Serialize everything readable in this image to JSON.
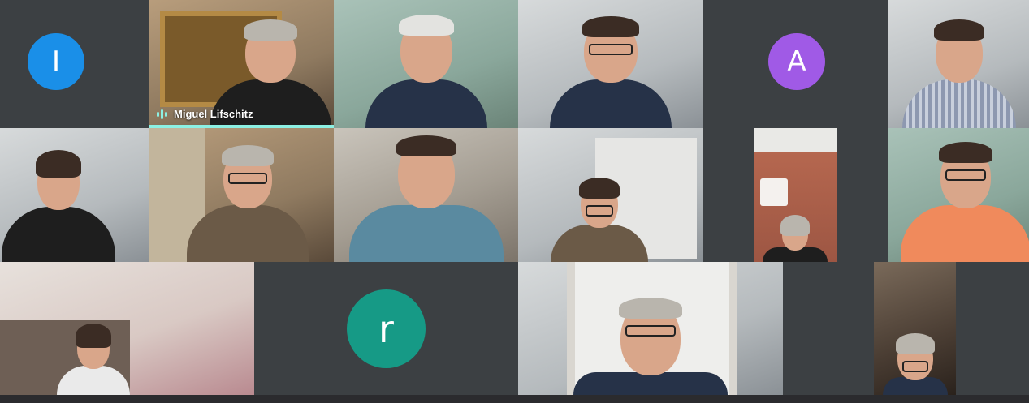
{
  "meeting": {
    "active_speaker": "Miguel Lifschitz",
    "colors": {
      "background": "#2b2b2e",
      "tile_empty": "#3c4043",
      "speaking_accent": "#8cf0e3"
    }
  },
  "avatars": [
    {
      "letter": "I",
      "color": "#1a8fe8"
    },
    {
      "letter": "A",
      "color": "#a05ae6"
    },
    {
      "letter": "r",
      "color": "#169a86"
    }
  ],
  "participants": {
    "speaker_name": "Miguel Lifschitz",
    "speaking_icon": "audio-bars-icon"
  }
}
